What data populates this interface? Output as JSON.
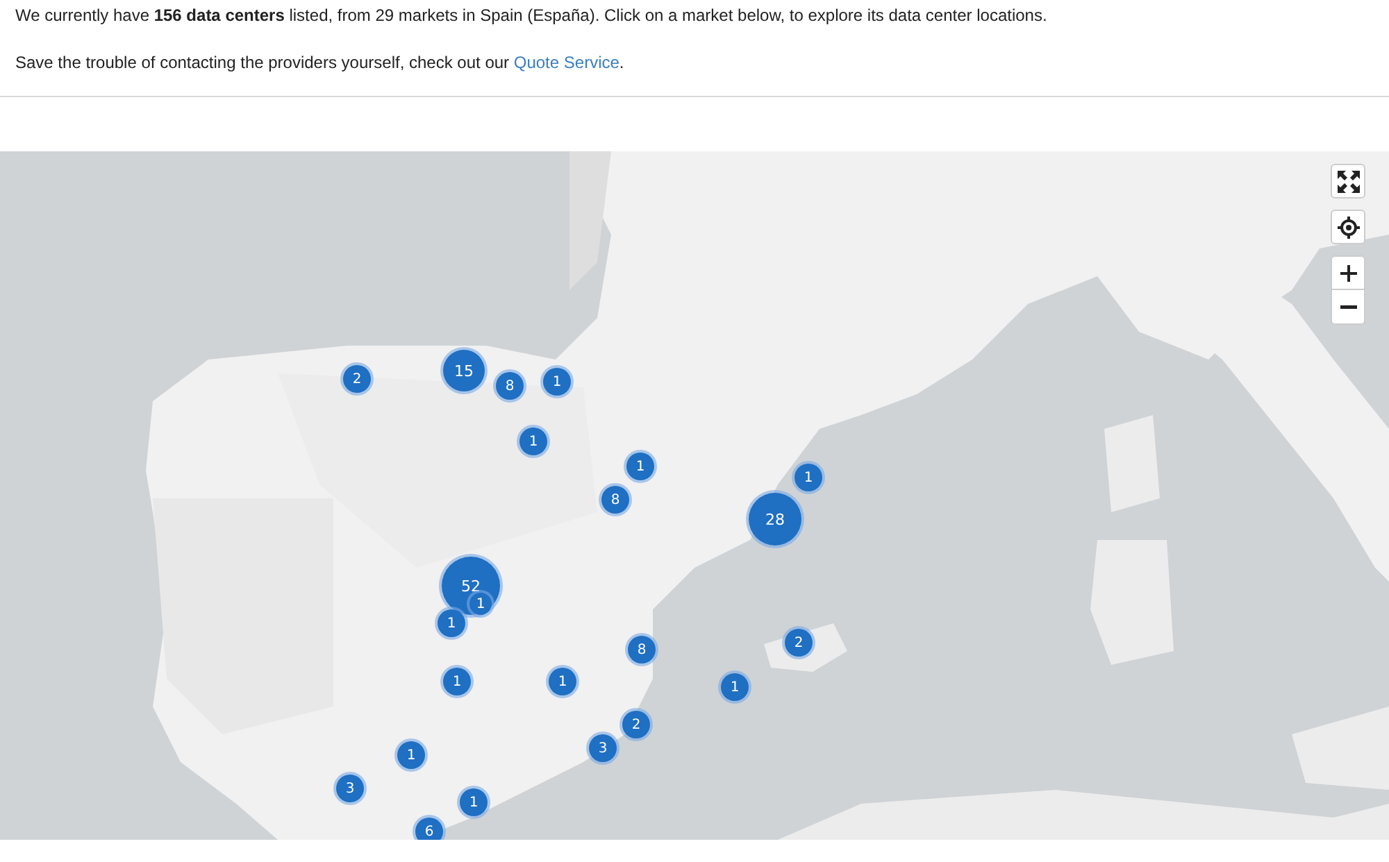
{
  "intro": "We currently have **156 data centers** listed, from 29 markets in Spain (España). Click on a market below, to explore its data center locations.",
  "quote": {
    "before": "Save the trouble of contacting the providers yourself, check out our ",
    "link": "Quote Service",
    "after": "."
  },
  "map": {
    "kind": "picture",
    "markers": [
      {
        "count": "2"
      },
      {
        "count": "15"
      },
      {
        "count": "8"
      },
      {
        "count": "1"
      },
      {
        "count": "1"
      },
      {
        "count": "1"
      },
      {
        "count": "8"
      },
      {
        "count": "1"
      },
      {
        "count": "28"
      },
      {
        "count": "52"
      },
      {
        "count": "1"
      },
      {
        "count": "1"
      },
      {
        "count": "2"
      },
      {
        "count": "8"
      },
      {
        "count": "1"
      },
      {
        "count": "1"
      },
      {
        "count": "1"
      },
      {
        "count": "2"
      },
      {
        "count": "3"
      },
      {
        "count": "1"
      },
      {
        "count": "3"
      },
      {
        "count": "1"
      },
      {
        "count": "6"
      }
    ],
    "controls": [
      {
        "kind": "fullscreen"
      },
      {
        "kind": "locate"
      },
      {
        "kind": "zoom-in"
      },
      {
        "kind": "zoom-out"
      }
    ]
  }
}
